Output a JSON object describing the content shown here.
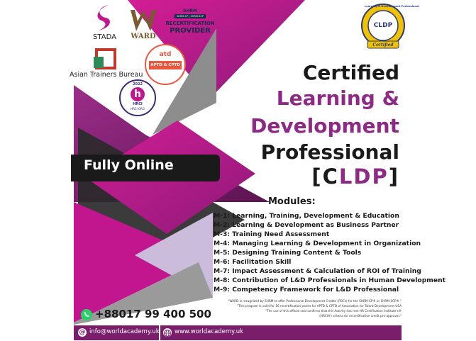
{
  "logos": {
    "stada": "STADA",
    "ward": "WARD",
    "shrm_top": "SHRM",
    "shrm_sub": "SHRM-CP | SHRM-SCP",
    "shrm_line1": "RECERTIFICATION",
    "shrm_line2": "PROVIDER",
    "asian_trainers": "Asian Trainers Bureau",
    "atd_brand": "atd",
    "atd_sub": "APTD & CPTD",
    "hrci_year": "2022",
    "hrci_letter": "h",
    "hrci_org": "HRCI",
    "hrci_url": "HRCI.ORG",
    "cldp_badge_arc": "Learning & Development Professional",
    "cldp_badge_text": "CLDP",
    "cldp_badge_ribbon": "Certified"
  },
  "title": {
    "line1": "Certified",
    "line2": "Learning &",
    "line3": "Development",
    "line4": "Professional",
    "abbr_open": "[C",
    "abbr_mid": "LDP",
    "abbr_close": "]"
  },
  "fully_online": "Fully Online",
  "modules": {
    "heading": "Modules:",
    "items": [
      "M-1: Learning, Training, Development & Education",
      "M-2: Learning & Development as Business Partner",
      "M-3: Training Need Assessment",
      "M-4: Managing Learning & Development in Organization",
      "M-5: Designing Training Content & Tools",
      "M-6: Facilitation Skill",
      "M-7: Impact Assessment & Calculation of ROI of Training",
      "M-8: Contribution of L&D Professionals in Human Development",
      "M-9: Competency Framework for L&D Professional"
    ]
  },
  "notes": [
    "\"WARD is recognized by SHRM to offer Professional Development Credits (PDCs) for the SHRM-CP® or SHRM-SCP®.\"",
    "\"This program is valid for 16 recertification points for APTD & CPTD of Association for Talent Development USA",
    "\"The use of this official seal confirms that this Activity has met HR Certification Institute's®",
    "(HRCI®) criteria for recertification credit pre-approval.\""
  ],
  "contact": {
    "phone": "+88017 99 400 500",
    "email": "info@worldacademy.uk",
    "website": "www.worldacademy.uk"
  },
  "colors": {
    "magenta": "#c2168f",
    "purple": "#7a1d6b",
    "dark": "#1a1a1a",
    "title_accent": "#8e2a86"
  }
}
